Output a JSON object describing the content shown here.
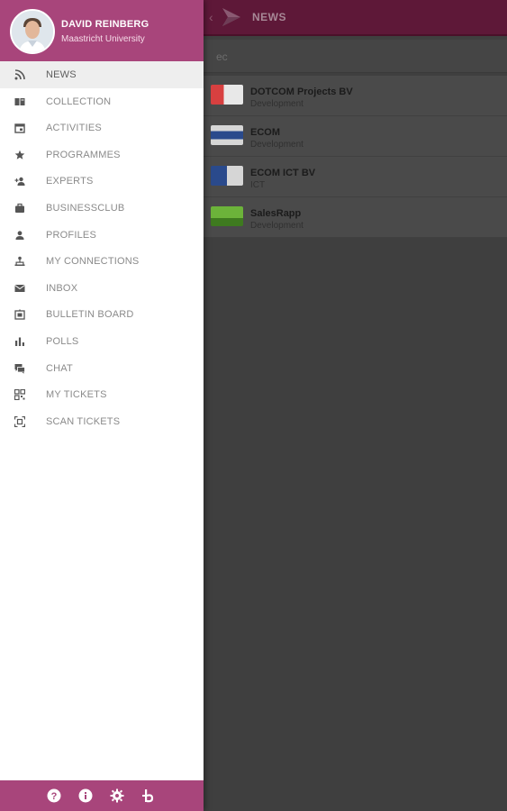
{
  "topbar": {
    "title": "NEWS"
  },
  "search": {
    "query": "ec"
  },
  "results": [
    {
      "name": "DOTCOM Projects BV",
      "category": "Development",
      "logo_color": "#c22a2a"
    },
    {
      "name": "ECOM",
      "category": "Development",
      "logo_color": "#2a4a8c"
    },
    {
      "name": "ECOM ICT BV",
      "category": "ICT",
      "logo_color": "#2a4a8c"
    },
    {
      "name": "SalesRapp",
      "category": "Development",
      "logo_color": "#5aa22a"
    }
  ],
  "user": {
    "name": "DAVID REINBERG",
    "organization": "Maastricht University"
  },
  "menu": [
    {
      "label": "NEWS",
      "icon": "rss-icon",
      "active": true
    },
    {
      "label": "COLLECTION",
      "icon": "book-icon"
    },
    {
      "label": "ACTIVITIES",
      "icon": "calendar-icon"
    },
    {
      "label": "PROGRAMMES",
      "icon": "star-icon"
    },
    {
      "label": "EXPERTS",
      "icon": "person-add-icon"
    },
    {
      "label": "BUSINESSCLUB",
      "icon": "briefcase-icon"
    },
    {
      "label": "PROFILES",
      "icon": "person-icon"
    },
    {
      "label": "MY CONNECTIONS",
      "icon": "hierarchy-icon"
    },
    {
      "label": "INBOX",
      "icon": "mail-icon"
    },
    {
      "label": "BULLETIN BOARD",
      "icon": "board-icon"
    },
    {
      "label": "POLLS",
      "icon": "bar-chart-icon"
    },
    {
      "label": "CHAT",
      "icon": "chat-icon"
    },
    {
      "label": "MY TICKETS",
      "icon": "qr-icon"
    },
    {
      "label": "SCAN TICKETS",
      "icon": "scan-icon"
    }
  ],
  "bottom_icons": [
    "help-icon",
    "info-icon",
    "settings-icon",
    "brand-icon"
  ],
  "colors": {
    "header": "#a8457b",
    "topbar": "#5e1838",
    "overlay": "#3f3f3f"
  }
}
